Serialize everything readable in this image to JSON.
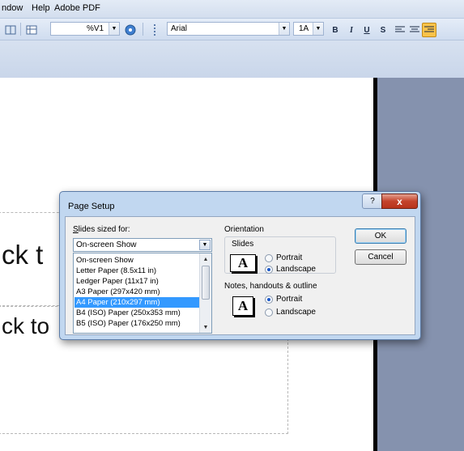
{
  "menu": {
    "items": [
      "ndow",
      "Help",
      "Adobe PDF"
    ]
  },
  "toolbar": {
    "zoom_value": "%V1",
    "font_name": "Arial",
    "font_size": "1A",
    "bold_glyph": "B",
    "italic_glyph": "I",
    "underline_glyph": "U",
    "shadow_glyph": "S"
  },
  "slide": {
    "title_fragment": "ck t",
    "body_fragment": "ck to"
  },
  "dialog": {
    "title": "Page Setup",
    "help_glyph": "?",
    "close_glyph": "x",
    "slides_sized_for": {
      "label_prefix": "S",
      "label_rest": "lides sized for:",
      "selected": "On-screen Show",
      "options": [
        "On-screen Show",
        "Letter Paper (8.5x11 in)",
        "Ledger Paper (11x17 in)",
        "A3 Paper (297x420 mm)",
        "A4 Paper (210x297 mm)",
        "B4 (ISO) Paper (250x353 mm)",
        "B5 (ISO) Paper (176x250 mm)"
      ],
      "highlighted_index": 4
    },
    "orientation": {
      "label": "Orientation",
      "slides_label": "Slides",
      "slides_portrait": "Portrait",
      "slides_landscape": "Landscape",
      "slides_selected": "landscape",
      "notes_label": "Notes, handouts & outline",
      "notes_portrait": "Portrait",
      "notes_landscape": "Landscape",
      "notes_selected": "portrait",
      "icon_letter": "A"
    },
    "ok_label": "OK",
    "cancel_label": "Cancel"
  },
  "colors": {
    "selection": "#3399ff",
    "dialog_frame": "#c1d7f0",
    "close_button": "#c4432b",
    "workspace_grey": "#8592ae"
  }
}
